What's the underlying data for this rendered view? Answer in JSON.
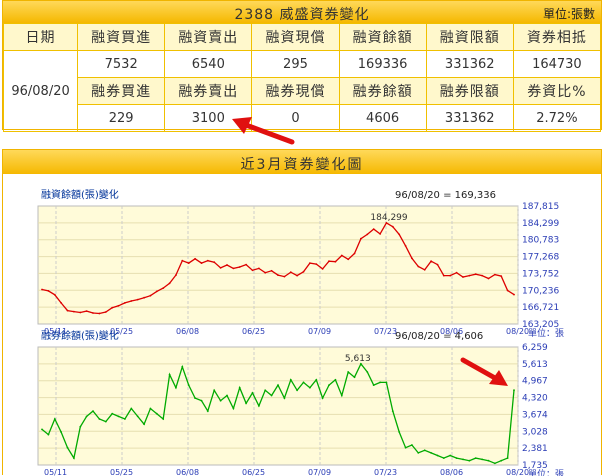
{
  "header": {
    "title": "2388 威盛資券變化",
    "unit": "單位:張數"
  },
  "table": {
    "date_label": "日期",
    "date": "96/08/20",
    "margin_headers": [
      "融資買進",
      "融資賣出",
      "融資現償",
      "融資餘額",
      "融資限額",
      "資券相抵"
    ],
    "margin_values": [
      "7532",
      "6540",
      "295",
      "169336",
      "331362",
      "164730"
    ],
    "short_headers": [
      "融券買進",
      "融券賣出",
      "融券現償",
      "融券餘額",
      "融券限額",
      "券資比%"
    ],
    "short_values": [
      "229",
      "3100",
      "0",
      "4606",
      "331362",
      "2.72%"
    ]
  },
  "chart_panel": {
    "title": "近3月資券變化圖"
  },
  "chart_data": [
    {
      "type": "line",
      "title": "融資餘額(張)變化",
      "latest": "96/08/20 = 169,336",
      "peak_label": "184,299",
      "unit": "單位：張",
      "color": "#dd0000",
      "yticks": [
        "187,815",
        "184,299",
        "180,783",
        "177,268",
        "173,752",
        "170,236",
        "166,721",
        "163,205"
      ],
      "ylim": [
        163205,
        187815
      ],
      "xticks": [
        "05/11",
        "05/25",
        "06/08",
        "06/25",
        "07/09",
        "07/23",
        "08/06",
        "08/20"
      ],
      "values": [
        170400,
        170100,
        169300,
        167600,
        166000,
        165800,
        165600,
        165900,
        165500,
        165400,
        165700,
        166600,
        167000,
        167600,
        168000,
        168300,
        168700,
        169100,
        170000,
        170700,
        171700,
        173400,
        176400,
        175900,
        176800,
        175900,
        176400,
        176100,
        174900,
        175500,
        174800,
        175100,
        175600,
        174400,
        174800,
        173900,
        174300,
        173400,
        173100,
        174000,
        173300,
        174100,
        175900,
        175700,
        174700,
        176300,
        176200,
        177500,
        176700,
        177900,
        181000,
        181900,
        183000,
        182000,
        184299,
        183500,
        181900,
        179500,
        176900,
        175200,
        174500,
        176300,
        175600,
        173300,
        173300,
        173900,
        173000,
        173300,
        173600,
        173300,
        172700,
        173500,
        173200,
        170200,
        169336
      ]
    },
    {
      "type": "line",
      "title": "融券餘額(張)變化",
      "latest": "96/08/20 = 4,606",
      "peak_label": "5,613",
      "unit": "單位：張",
      "color": "#00aa00",
      "yticks": [
        "6,259",
        "5,613",
        "4,967",
        "4,320",
        "3,674",
        "3,028",
        "2,381",
        "1,735"
      ],
      "ylim": [
        1735,
        6259
      ],
      "xticks": [
        "05/11",
        "05/25",
        "06/08",
        "06/25",
        "07/09",
        "07/23",
        "08/06",
        "08/20"
      ],
      "values": [
        3100,
        2900,
        3500,
        3000,
        2400,
        2000,
        3200,
        3600,
        3800,
        3500,
        3400,
        3700,
        3600,
        3500,
        3900,
        3600,
        3300,
        3900,
        3700,
        3500,
        5200,
        4700,
        5500,
        4800,
        4300,
        4200,
        3800,
        4600,
        4200,
        4400,
        3900,
        4700,
        4100,
        4500,
        4000,
        4600,
        4400,
        4800,
        4300,
        5000,
        4600,
        4900,
        4700,
        5000,
        4300,
        4800,
        5000,
        4400,
        5300,
        5100,
        5613,
        5300,
        4800,
        4900,
        4900,
        3800,
        3000,
        2400,
        2500,
        2200,
        2300,
        2200,
        2100,
        2000,
        2100,
        2000,
        1950,
        1900,
        2000,
        1950,
        1900,
        1800,
        1900,
        2000,
        4606
      ]
    }
  ]
}
